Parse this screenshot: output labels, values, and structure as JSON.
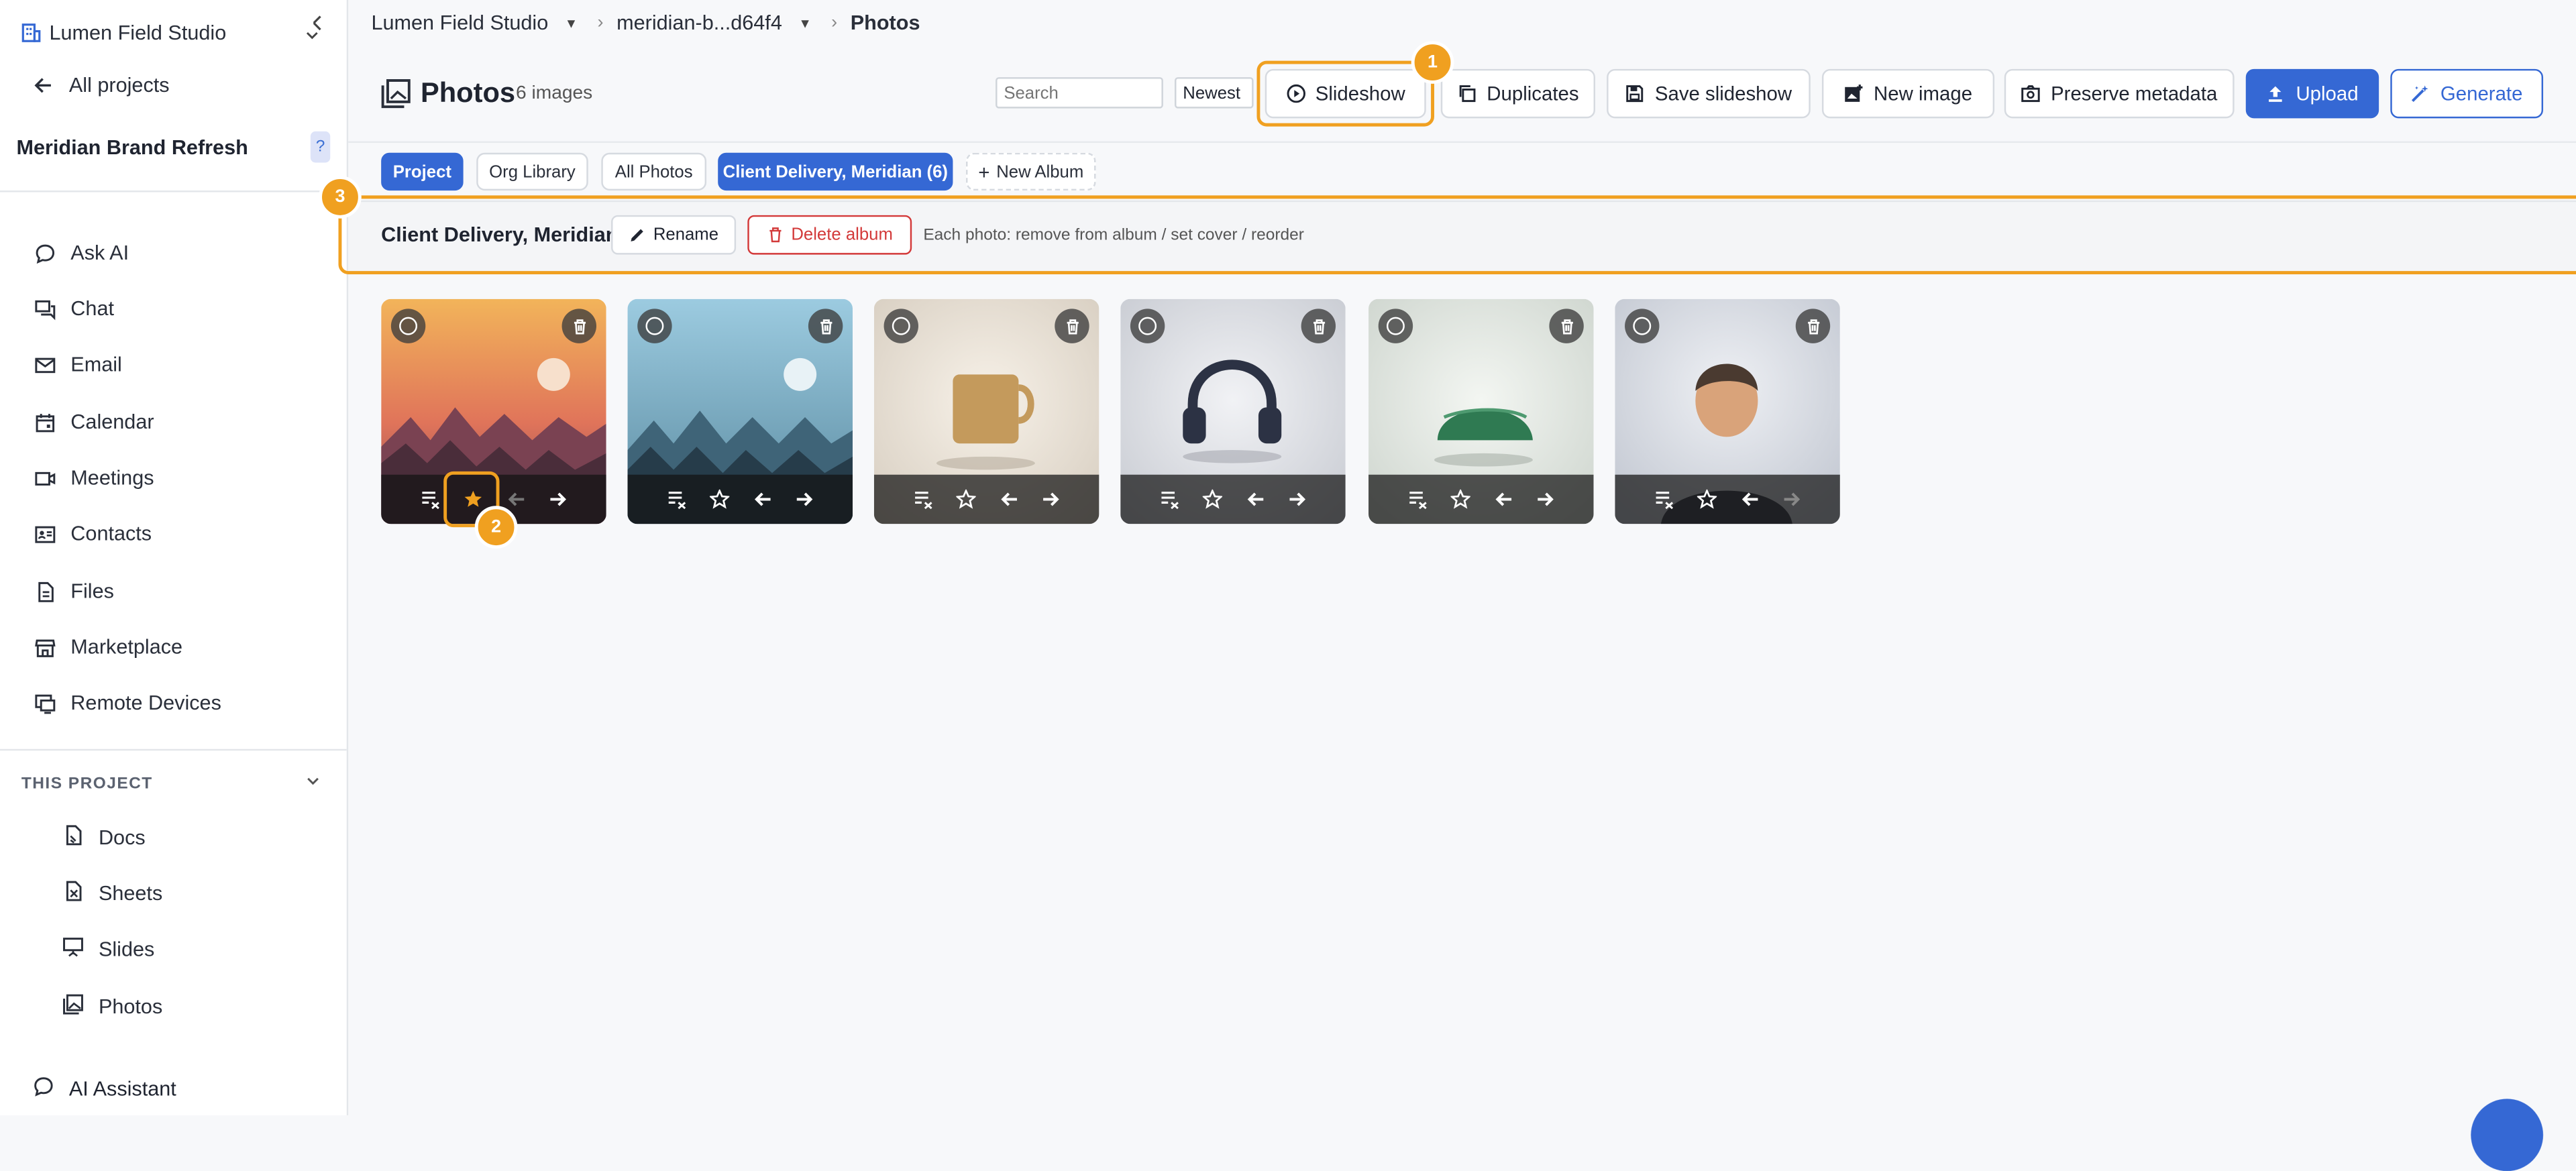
{
  "sidebar": {
    "workspace": "Lumen Field Studio",
    "back_label": "All projects",
    "project_name": "Meridian Brand Refresh",
    "help": "?",
    "items": [
      {
        "label": "Ask AI",
        "icon": "chat-bubble-icon"
      },
      {
        "label": "Chat",
        "icon": "chat-icon"
      },
      {
        "label": "Email",
        "icon": "mail-icon"
      },
      {
        "label": "Calendar",
        "icon": "calendar-icon"
      },
      {
        "label": "Meetings",
        "icon": "video-icon"
      },
      {
        "label": "Contacts",
        "icon": "contact-card-icon"
      },
      {
        "label": "Files",
        "icon": "file-icon"
      },
      {
        "label": "Marketplace",
        "icon": "store-icon"
      },
      {
        "label": "Remote Devices",
        "icon": "monitor-icon"
      }
    ],
    "section_title": "THIS PROJECT",
    "project_items": [
      {
        "label": "Docs",
        "icon": "doc-icon"
      },
      {
        "label": "Sheets",
        "icon": "sheet-icon"
      },
      {
        "label": "Slides",
        "icon": "presentation-icon"
      },
      {
        "label": "Photos",
        "icon": "photos-icon"
      }
    ],
    "ai_assistant": "AI Assistant"
  },
  "breadcrumb": {
    "org": "Lumen Field Studio",
    "project": "meridian-b...d64f4",
    "current": "Photos"
  },
  "header": {
    "title": "Photos",
    "count": "6 images",
    "search_placeholder": "Search",
    "sort": "Newest",
    "buttons": {
      "slideshow": "Slideshow",
      "duplicates": "Duplicates",
      "save_slideshow": "Save slideshow",
      "new_image": "New image",
      "preserve_metadata": "Preserve metadata",
      "upload": "Upload",
      "generate": "Generate"
    }
  },
  "albums": [
    {
      "label": "Project",
      "active": true
    },
    {
      "label": "Org Library",
      "active": false
    },
    {
      "label": "All Photos",
      "active": false
    },
    {
      "label": "Client Delivery, Meridian (6)",
      "active": true
    }
  ],
  "new_album": "New Album",
  "album_bar": {
    "name": "Client Delivery, Meridian",
    "rename": "Rename",
    "delete": "Delete album",
    "hint": "Each photo: remove from album / set cover / reorder"
  },
  "annotations": [
    "1",
    "2",
    "3"
  ],
  "photos": [
    {
      "subject": "sunset-mountains",
      "cover": true
    },
    {
      "subject": "blue-mountains",
      "cover": false
    },
    {
      "subject": "coffee-mug",
      "cover": false
    },
    {
      "subject": "headphones",
      "cover": false
    },
    {
      "subject": "green-cap",
      "cover": false
    },
    {
      "subject": "portrait",
      "cover": false
    }
  ],
  "colors": {
    "primary": "#3568d4",
    "highlight": "#f0a020",
    "danger": "#d33a3a"
  }
}
